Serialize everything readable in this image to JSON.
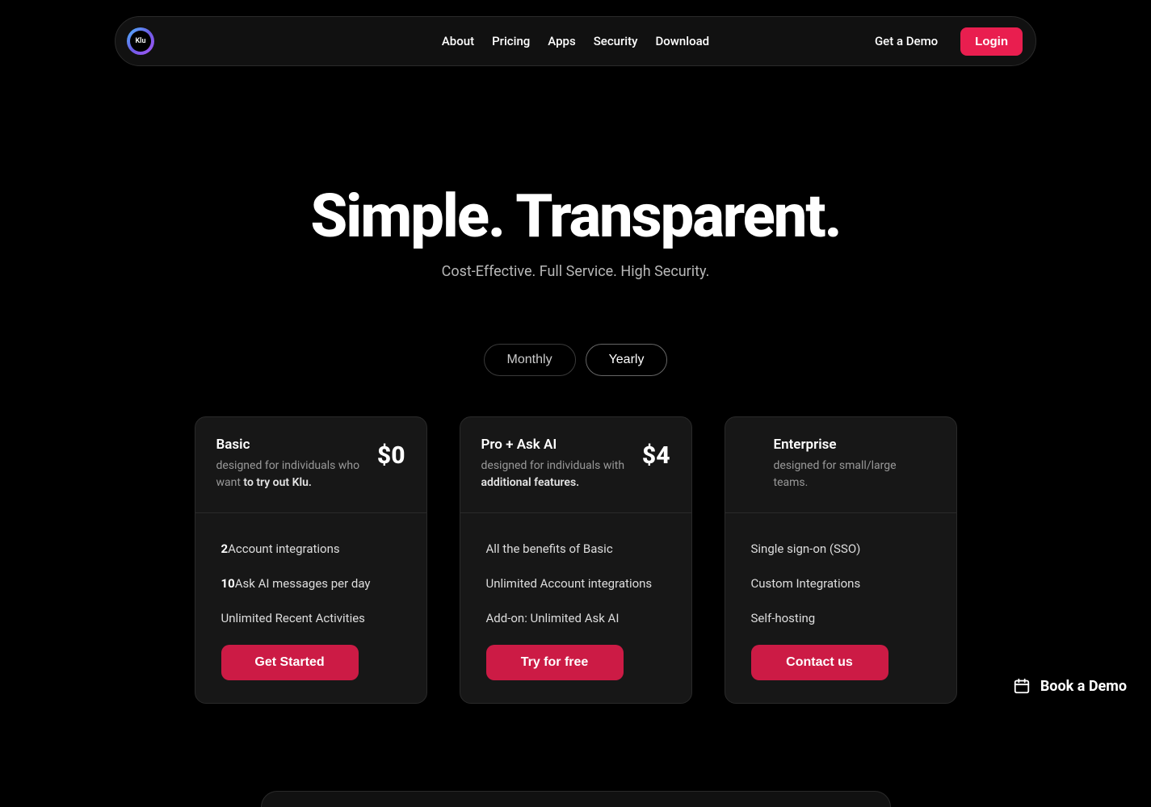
{
  "nav": {
    "logo_text": "Klu",
    "links": [
      "About",
      "Pricing",
      "Apps",
      "Security",
      "Download"
    ],
    "demo": "Get a Demo",
    "login": "Login"
  },
  "hero": {
    "title": "Simple. Transparent.",
    "subtitle": "Cost-Effective. Full Service. High Security."
  },
  "toggle": {
    "monthly": "Monthly",
    "yearly": "Yearly",
    "selected": "yearly"
  },
  "plans": [
    {
      "name": "Basic",
      "desc_pre": "designed for individuals who want ",
      "desc_strong": "to try out Klu.",
      "price": "$0",
      "features": [
        {
          "strong": "2",
          "rest": "Account integrations"
        },
        {
          "strong": "10",
          "rest": "Ask AI messages per day"
        },
        {
          "strong": "",
          "rest": "Unlimited Recent Activities"
        }
      ],
      "cta": "Get Started"
    },
    {
      "name": "Pro + Ask AI",
      "desc_pre": "designed for individuals with ",
      "desc_strong": "additional features.",
      "price": "$4",
      "features": [
        {
          "strong": "",
          "rest": "All the benefits of Basic"
        },
        {
          "strong": "",
          "rest": "Unlimited Account integrations"
        },
        {
          "strong": "",
          "rest": "Add-on: Unlimited Ask AI"
        }
      ],
      "cta": "Try for free"
    },
    {
      "name": "Enterprise",
      "desc_pre": "designed for small/large teams.",
      "desc_strong": "",
      "price": "",
      "features": [
        {
          "strong": "",
          "rest": "Single sign-on (SSO)"
        },
        {
          "strong": "",
          "rest": "Custom Integrations"
        },
        {
          "strong": "",
          "rest": "Self-hosting"
        }
      ],
      "cta": "Contact us"
    }
  ],
  "fab": {
    "label": "Book a Demo"
  }
}
